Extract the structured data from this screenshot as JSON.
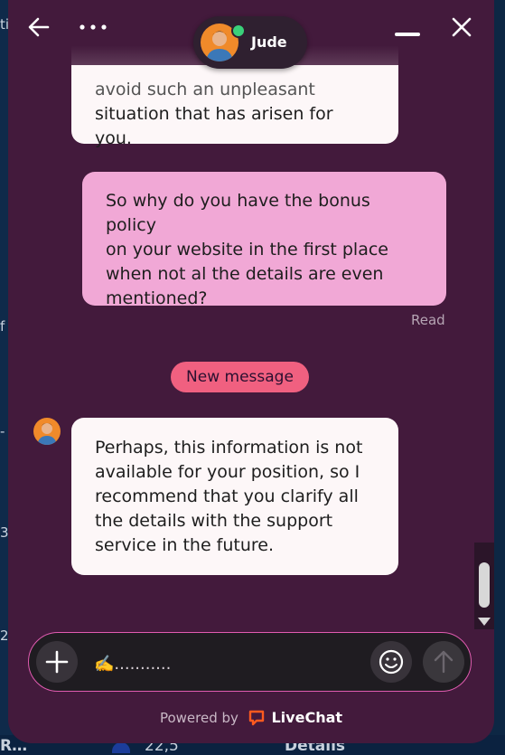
{
  "background": {
    "left_fragments": [
      "ti",
      "f",
      "-",
      "3",
      "2."
    ],
    "bottom_fragments": [
      "R…",
      "22,5",
      "Details"
    ]
  },
  "header": {
    "agent_name": "Jude",
    "icons": [
      "back-arrow-icon",
      "more-dots-icon",
      "minimize-icon",
      "close-icon"
    ],
    "online_color": "#3ad17a"
  },
  "messages": [
    {
      "author": "agent",
      "text_lines": [
        "avoid such an unpleasant",
        "situation that has arisen for you."
      ]
    },
    {
      "author": "user",
      "text_lines": [
        "So why do you have the bonus policy",
        "on your website in the first place",
        "when not al the details are even",
        "mentioned?"
      ],
      "status": "Read"
    },
    {
      "author": "agent",
      "text_lines": [
        "Perhaps, this information is not",
        "available for your position, so I",
        "recommend that you clarify all",
        "the details with the support",
        "service in the future."
      ]
    }
  ],
  "divider": {
    "new_message_label": "New message",
    "color": "#f06080"
  },
  "composer": {
    "input_value": "✍️...........",
    "border_color": "#e05bb0",
    "icons": [
      "plus-icon",
      "emoji-icon",
      "send-arrow-icon"
    ]
  },
  "footer": {
    "powered_by": "Powered by",
    "brand": "LiveChat",
    "brand_color": "#ff5a1f"
  },
  "colors": {
    "panel": "#431a3c",
    "user_bubble": "#f1a8d6",
    "agent_bubble": "#fdf7f8"
  }
}
